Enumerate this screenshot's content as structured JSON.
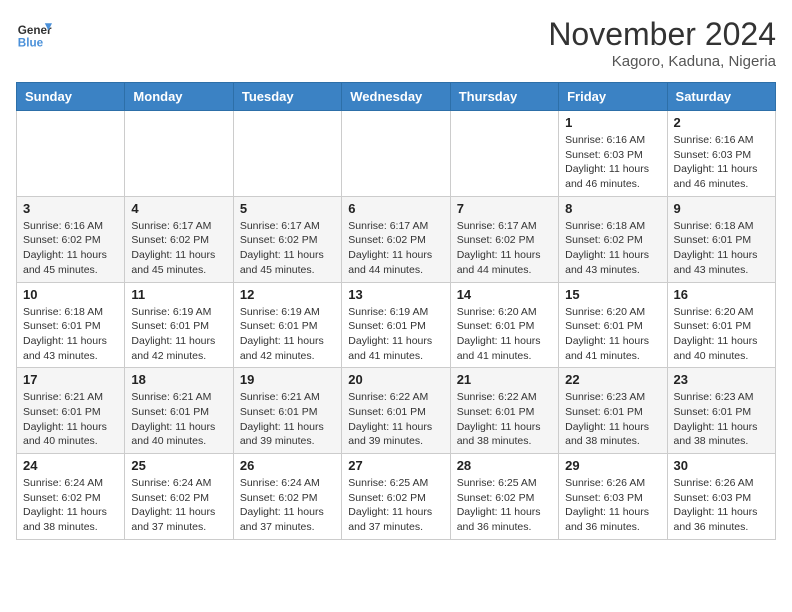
{
  "header": {
    "logo_line1": "General",
    "logo_line2": "Blue",
    "month": "November 2024",
    "location": "Kagoro, Kaduna, Nigeria"
  },
  "weekdays": [
    "Sunday",
    "Monday",
    "Tuesday",
    "Wednesday",
    "Thursday",
    "Friday",
    "Saturday"
  ],
  "weeks": [
    [
      {
        "day": "",
        "info": ""
      },
      {
        "day": "",
        "info": ""
      },
      {
        "day": "",
        "info": ""
      },
      {
        "day": "",
        "info": ""
      },
      {
        "day": "",
        "info": ""
      },
      {
        "day": "1",
        "info": "Sunrise: 6:16 AM\nSunset: 6:03 PM\nDaylight: 11 hours and 46 minutes."
      },
      {
        "day": "2",
        "info": "Sunrise: 6:16 AM\nSunset: 6:03 PM\nDaylight: 11 hours and 46 minutes."
      }
    ],
    [
      {
        "day": "3",
        "info": "Sunrise: 6:16 AM\nSunset: 6:02 PM\nDaylight: 11 hours and 45 minutes."
      },
      {
        "day": "4",
        "info": "Sunrise: 6:17 AM\nSunset: 6:02 PM\nDaylight: 11 hours and 45 minutes."
      },
      {
        "day": "5",
        "info": "Sunrise: 6:17 AM\nSunset: 6:02 PM\nDaylight: 11 hours and 45 minutes."
      },
      {
        "day": "6",
        "info": "Sunrise: 6:17 AM\nSunset: 6:02 PM\nDaylight: 11 hours and 44 minutes."
      },
      {
        "day": "7",
        "info": "Sunrise: 6:17 AM\nSunset: 6:02 PM\nDaylight: 11 hours and 44 minutes."
      },
      {
        "day": "8",
        "info": "Sunrise: 6:18 AM\nSunset: 6:02 PM\nDaylight: 11 hours and 43 minutes."
      },
      {
        "day": "9",
        "info": "Sunrise: 6:18 AM\nSunset: 6:01 PM\nDaylight: 11 hours and 43 minutes."
      }
    ],
    [
      {
        "day": "10",
        "info": "Sunrise: 6:18 AM\nSunset: 6:01 PM\nDaylight: 11 hours and 43 minutes."
      },
      {
        "day": "11",
        "info": "Sunrise: 6:19 AM\nSunset: 6:01 PM\nDaylight: 11 hours and 42 minutes."
      },
      {
        "day": "12",
        "info": "Sunrise: 6:19 AM\nSunset: 6:01 PM\nDaylight: 11 hours and 42 minutes."
      },
      {
        "day": "13",
        "info": "Sunrise: 6:19 AM\nSunset: 6:01 PM\nDaylight: 11 hours and 41 minutes."
      },
      {
        "day": "14",
        "info": "Sunrise: 6:20 AM\nSunset: 6:01 PM\nDaylight: 11 hours and 41 minutes."
      },
      {
        "day": "15",
        "info": "Sunrise: 6:20 AM\nSunset: 6:01 PM\nDaylight: 11 hours and 41 minutes."
      },
      {
        "day": "16",
        "info": "Sunrise: 6:20 AM\nSunset: 6:01 PM\nDaylight: 11 hours and 40 minutes."
      }
    ],
    [
      {
        "day": "17",
        "info": "Sunrise: 6:21 AM\nSunset: 6:01 PM\nDaylight: 11 hours and 40 minutes."
      },
      {
        "day": "18",
        "info": "Sunrise: 6:21 AM\nSunset: 6:01 PM\nDaylight: 11 hours and 40 minutes."
      },
      {
        "day": "19",
        "info": "Sunrise: 6:21 AM\nSunset: 6:01 PM\nDaylight: 11 hours and 39 minutes."
      },
      {
        "day": "20",
        "info": "Sunrise: 6:22 AM\nSunset: 6:01 PM\nDaylight: 11 hours and 39 minutes."
      },
      {
        "day": "21",
        "info": "Sunrise: 6:22 AM\nSunset: 6:01 PM\nDaylight: 11 hours and 38 minutes."
      },
      {
        "day": "22",
        "info": "Sunrise: 6:23 AM\nSunset: 6:01 PM\nDaylight: 11 hours and 38 minutes."
      },
      {
        "day": "23",
        "info": "Sunrise: 6:23 AM\nSunset: 6:01 PM\nDaylight: 11 hours and 38 minutes."
      }
    ],
    [
      {
        "day": "24",
        "info": "Sunrise: 6:24 AM\nSunset: 6:02 PM\nDaylight: 11 hours and 38 minutes."
      },
      {
        "day": "25",
        "info": "Sunrise: 6:24 AM\nSunset: 6:02 PM\nDaylight: 11 hours and 37 minutes."
      },
      {
        "day": "26",
        "info": "Sunrise: 6:24 AM\nSunset: 6:02 PM\nDaylight: 11 hours and 37 minutes."
      },
      {
        "day": "27",
        "info": "Sunrise: 6:25 AM\nSunset: 6:02 PM\nDaylight: 11 hours and 37 minutes."
      },
      {
        "day": "28",
        "info": "Sunrise: 6:25 AM\nSunset: 6:02 PM\nDaylight: 11 hours and 36 minutes."
      },
      {
        "day": "29",
        "info": "Sunrise: 6:26 AM\nSunset: 6:03 PM\nDaylight: 11 hours and 36 minutes."
      },
      {
        "day": "30",
        "info": "Sunrise: 6:26 AM\nSunset: 6:03 PM\nDaylight: 11 hours and 36 minutes."
      }
    ]
  ]
}
